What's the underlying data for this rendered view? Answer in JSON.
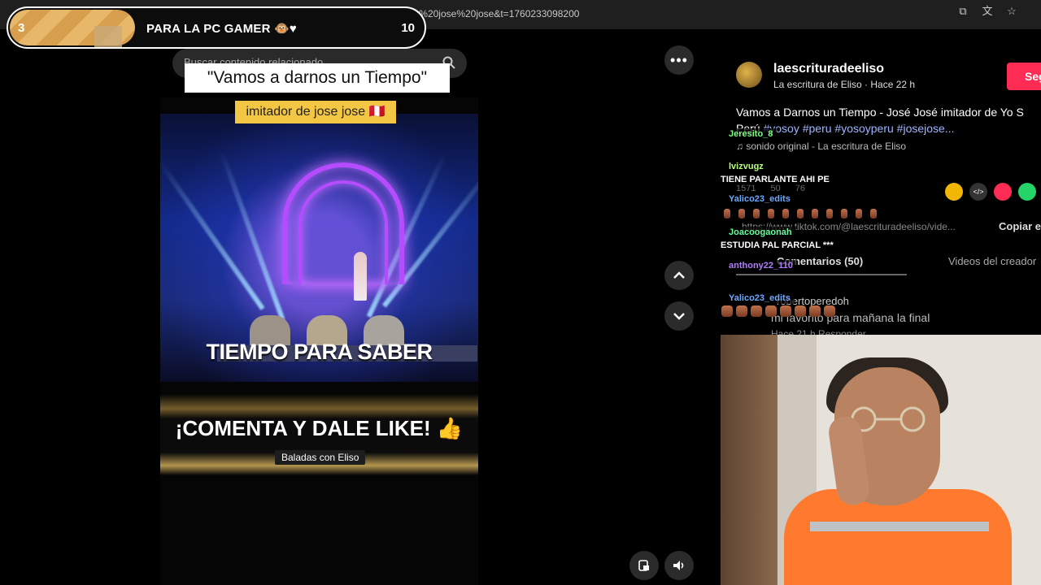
{
  "browser": {
    "url": "scrituradeeliso/video/7559801310434921736?q=yo%20soy%20peru%20jose%20jose&t=1760233098200",
    "icons": [
      "screen-share-icon",
      "translate-icon",
      "star-icon"
    ]
  },
  "goal": {
    "current": "3",
    "title": "PARA LA PC GAMER 🐵♥",
    "target": "10",
    "progress_fraction": 0.3
  },
  "search": {
    "placeholder": "Buscar contenido relacionado"
  },
  "video": {
    "caption_top": "\"Vamos a darnos un Tiempo\"",
    "caption_sub": "imitador de jose jose 🇵🇪",
    "banner_one": "TIEMPO PARA SABER",
    "banner_two": "¡COMENTA Y DALE LIKE! 👍",
    "channel_pill": "Baladas con Eliso"
  },
  "right_panel": {
    "author_handle": "laescrituradeeliso",
    "author_sub": "La escritura de Eliso · Hace 22 h",
    "follow_label": "Seg",
    "description": "Vamos a Darnos un Tiempo - José José imitador de Yo S",
    "description_line2_prefix": "Perú ",
    "hashtags": "#yosoy #peru #yosoyperu #josejose...",
    "sound": "♫ sonido original - La escritura de Eliso",
    "likes": "1571",
    "comments_count": "50",
    "saves": "76",
    "link": "https://www.tiktok.com/@laescrituradeeliso/vide...",
    "copy_label": "Copiar e",
    "tab_comments": "Comentarios (50)",
    "tab_videos": "Videos del creador",
    "comment_user": "robertoperedoh",
    "comment_text": "mi favorito para mañana la final",
    "comment_meta": "Hace 21 h    Responder"
  },
  "chat": [
    {
      "user": "Jeresito_8",
      "color": "#7fff7f",
      "message": ""
    },
    {
      "user": "lvizvugz",
      "color": "#b6ff7a",
      "message": "TIENE PARLANTE AHI PE"
    },
    {
      "user": "Yalico23_edits",
      "color": "#6fa8ff",
      "message": ""
    },
    {
      "user": "Joacoogaonah",
      "color": "#66ff99",
      "message": "ESTUDIA PAL PARCIAL ***"
    },
    {
      "user": "anthony22_110",
      "color": "#b27cff",
      "message": ""
    },
    {
      "user": "Yalico23_edits",
      "color": "#6fa8ff",
      "message": ""
    }
  ],
  "colors": {
    "accent": "#fe2c55",
    "caption_yellow": "#f3c643"
  }
}
